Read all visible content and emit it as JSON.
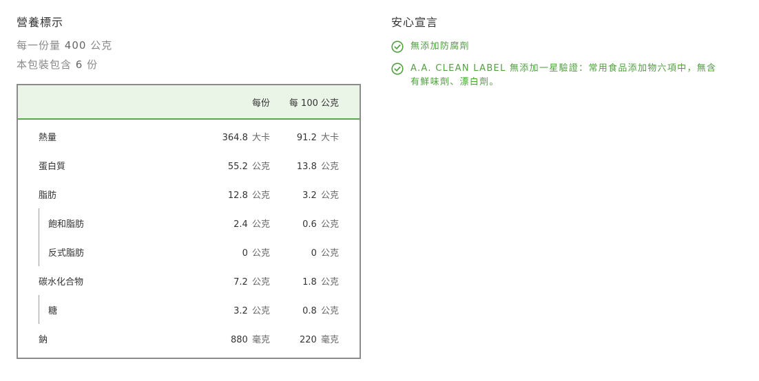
{
  "nutrition": {
    "title": "營養標示",
    "serving_size_prefix": "每一份量",
    "serving_size_value": "400",
    "serving_size_unit": "公克",
    "servings_prefix": "本包裝包含",
    "servings_value": "6",
    "servings_unit": "份",
    "columns": {
      "per_serving": "每份",
      "per_100g": "每 100 公克"
    },
    "rows": [
      {
        "label": "熱量",
        "per_serving": "364.8",
        "per_serving_unit": "大卡",
        "per_100g": "91.2",
        "per_100g_unit": "大卡",
        "sub": false
      },
      {
        "label": "蛋白質",
        "per_serving": "55.2",
        "per_serving_unit": "公克",
        "per_100g": "13.8",
        "per_100g_unit": "公克",
        "sub": false
      },
      {
        "label": "脂肪",
        "per_serving": "12.8",
        "per_serving_unit": "公克",
        "per_100g": "3.2",
        "per_100g_unit": "公克",
        "sub": false
      },
      {
        "label": "飽和脂肪",
        "per_serving": "2.4",
        "per_serving_unit": "公克",
        "per_100g": "0.6",
        "per_100g_unit": "公克",
        "sub": true
      },
      {
        "label": "反式脂肪",
        "per_serving": "0",
        "per_serving_unit": "公克",
        "per_100g": "0",
        "per_100g_unit": "公克",
        "sub": true
      },
      {
        "label": "碳水化合物",
        "per_serving": "7.2",
        "per_serving_unit": "公克",
        "per_100g": "1.8",
        "per_100g_unit": "公克",
        "sub": false
      },
      {
        "label": "糖",
        "per_serving": "3.2",
        "per_serving_unit": "公克",
        "per_100g": "0.8",
        "per_100g_unit": "公克",
        "sub": true
      },
      {
        "label": "鈉",
        "per_serving": "880",
        "per_serving_unit": "毫克",
        "per_100g": "220",
        "per_100g_unit": "毫克",
        "sub": false
      }
    ]
  },
  "claims": {
    "title": "安心宣言",
    "items": [
      {
        "text": "無添加防腐劑",
        "icon": "check-circle-icon"
      },
      {
        "text": "A.A. CLEAN LABEL 無添加一星驗證：常用食品添加物六項中，無含有鮮味劑、漂白劑。",
        "icon": "check-circle-icon"
      }
    ],
    "accent_color": "#4f9f3e"
  },
  "colors": {
    "header_bg": "#eaf4e7",
    "header_border": "#5aa64a",
    "table_border": "#8a8a8a"
  }
}
